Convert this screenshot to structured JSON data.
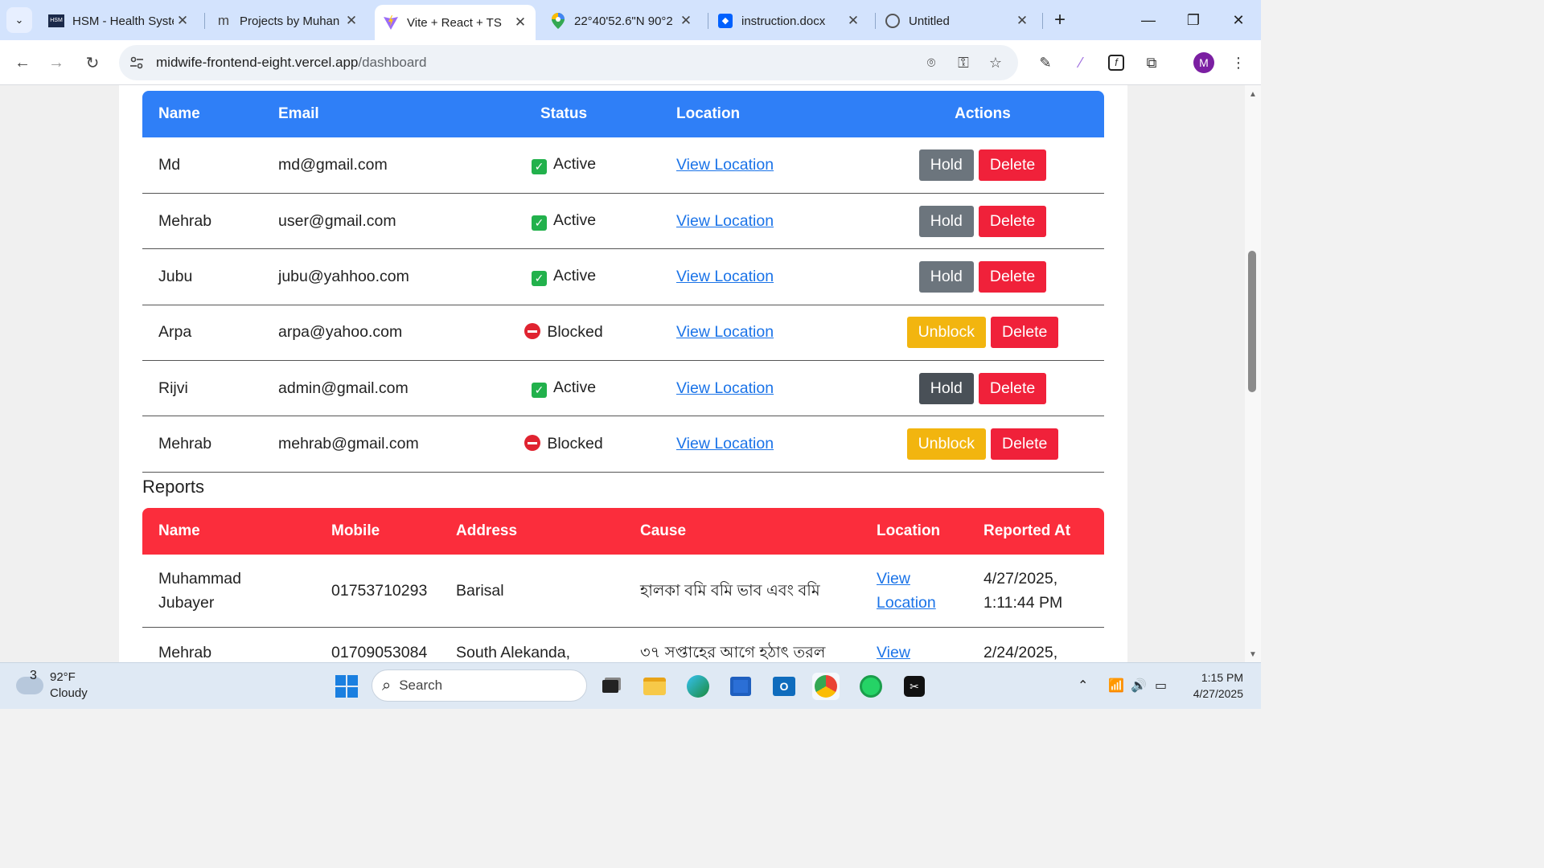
{
  "browser": {
    "tabs": [
      {
        "title": "HSM - Health Syste",
        "favicon": "hsm-logo",
        "active": false
      },
      {
        "title": "Projects by Muhan",
        "favicon": "m-logo",
        "active": false
      },
      {
        "title": "Vite + React + TS",
        "favicon": "vite-logo",
        "active": true
      },
      {
        "title": "22°40'52.6\"N 90°2",
        "favicon": "maps-pin",
        "active": false
      },
      {
        "title": "instruction.docx",
        "favicon": "dropbox-logo",
        "active": false
      },
      {
        "title": "Untitled",
        "favicon": "globe",
        "active": false
      }
    ],
    "url_host": "midwife-frontend-eight.vercel.app",
    "url_path": "/dashboard",
    "profile_initial": "M"
  },
  "users_table": {
    "headers": {
      "name": "Name",
      "email": "Email",
      "status": "Status",
      "location": "Location",
      "actions": "Actions"
    },
    "rows": [
      {
        "name": "Md",
        "email": "md@gmail.com",
        "status": "Active",
        "location_link": "View Location",
        "primary_action": "Hold",
        "delete": "Delete"
      },
      {
        "name": "Mehrab",
        "email": "user@gmail.com",
        "status": "Active",
        "location_link": "View Location",
        "primary_action": "Hold",
        "delete": "Delete"
      },
      {
        "name": "Jubu",
        "email": "jubu@yahhoo.com",
        "status": "Active",
        "location_link": "View Location",
        "primary_action": "Hold",
        "delete": "Delete"
      },
      {
        "name": "Arpa",
        "email": "arpa@yahoo.com",
        "status": "Blocked",
        "location_link": "View Location",
        "primary_action": "Unblock",
        "delete": "Delete"
      },
      {
        "name": "Rijvi",
        "email": "admin@gmail.com",
        "status": "Active",
        "location_link": "View Location",
        "primary_action": "Hold",
        "delete": "Delete"
      },
      {
        "name": "Mehrab",
        "email": "mehrab@gmail.com",
        "status": "Blocked",
        "location_link": "View Location",
        "primary_action": "Unblock",
        "delete": "Delete"
      }
    ]
  },
  "reports": {
    "title": "Reports",
    "headers": {
      "name": "Name",
      "mobile": "Mobile",
      "address": "Address",
      "cause": "Cause",
      "location": "Location",
      "reported_at": "Reported At"
    },
    "rows": [
      {
        "name": "Muhammad Jubayer",
        "mobile": "01753710293",
        "address": "Barisal",
        "cause": "হালকা বমি বমি ভাব এবং বমি",
        "location_link": "View Location",
        "reported_at": "4/27/2025, 1:11:44 PM"
      },
      {
        "name": "Mehrab",
        "mobile": "01709053084",
        "address": "South Alekanda,",
        "cause": "৩৭ সপ্তাহের আগে হঠাৎ তরল",
        "location_link": "View",
        "reported_at": "2/24/2025,"
      }
    ]
  },
  "taskbar": {
    "weather_temp": "92°F",
    "weather_desc": "Cloudy",
    "weather_badge": "3",
    "search_label": "Search",
    "time": "1:15 PM",
    "date": "4/27/2025"
  },
  "colors": {
    "users_header": "#2f7ff7",
    "reports_header": "#fb2d3c",
    "hold": "#6c757d",
    "delete": "#f0213a",
    "unblock": "#f2b50f",
    "active_check": "#22b14c",
    "blocked": "#e02330"
  }
}
